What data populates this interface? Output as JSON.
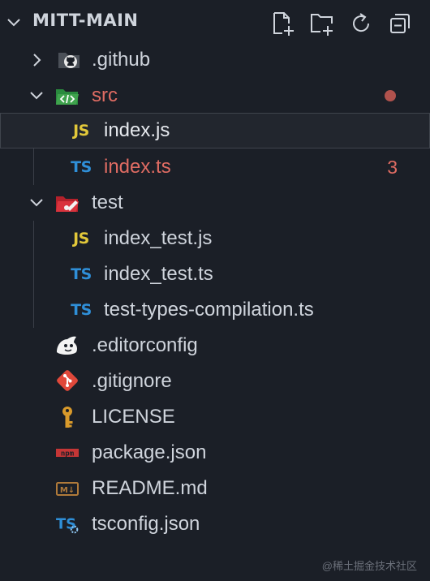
{
  "explorer": {
    "title": "MITT-MAIN",
    "actions": [
      "new-file-icon",
      "new-folder-icon",
      "refresh-icon",
      "collapse-all-icon"
    ]
  },
  "tree": {
    "github_folder": ".github",
    "src_folder": "src",
    "src_status": "modified",
    "index_js": "index.js",
    "index_ts": "index.ts",
    "index_ts_problems": "3",
    "test_folder": "test",
    "index_test_js": "index_test.js",
    "index_test_ts": "index_test.ts",
    "test_types": "test-types-compilation.ts",
    "editorconfig": ".editorconfig",
    "gitignore": ".gitignore",
    "license": "LICENSE",
    "package_json": "package.json",
    "readme": "README.md",
    "tsconfig": "tsconfig.json"
  },
  "badges": {
    "js": "JS",
    "ts": "TS",
    "npm": "npm",
    "md": "M↓"
  },
  "colors": {
    "background": "#1b1f27",
    "modified": "#e06c63",
    "ts": "#2f8fd8",
    "js": "#e2c83a"
  },
  "watermark": "@稀土掘金技术社区"
}
